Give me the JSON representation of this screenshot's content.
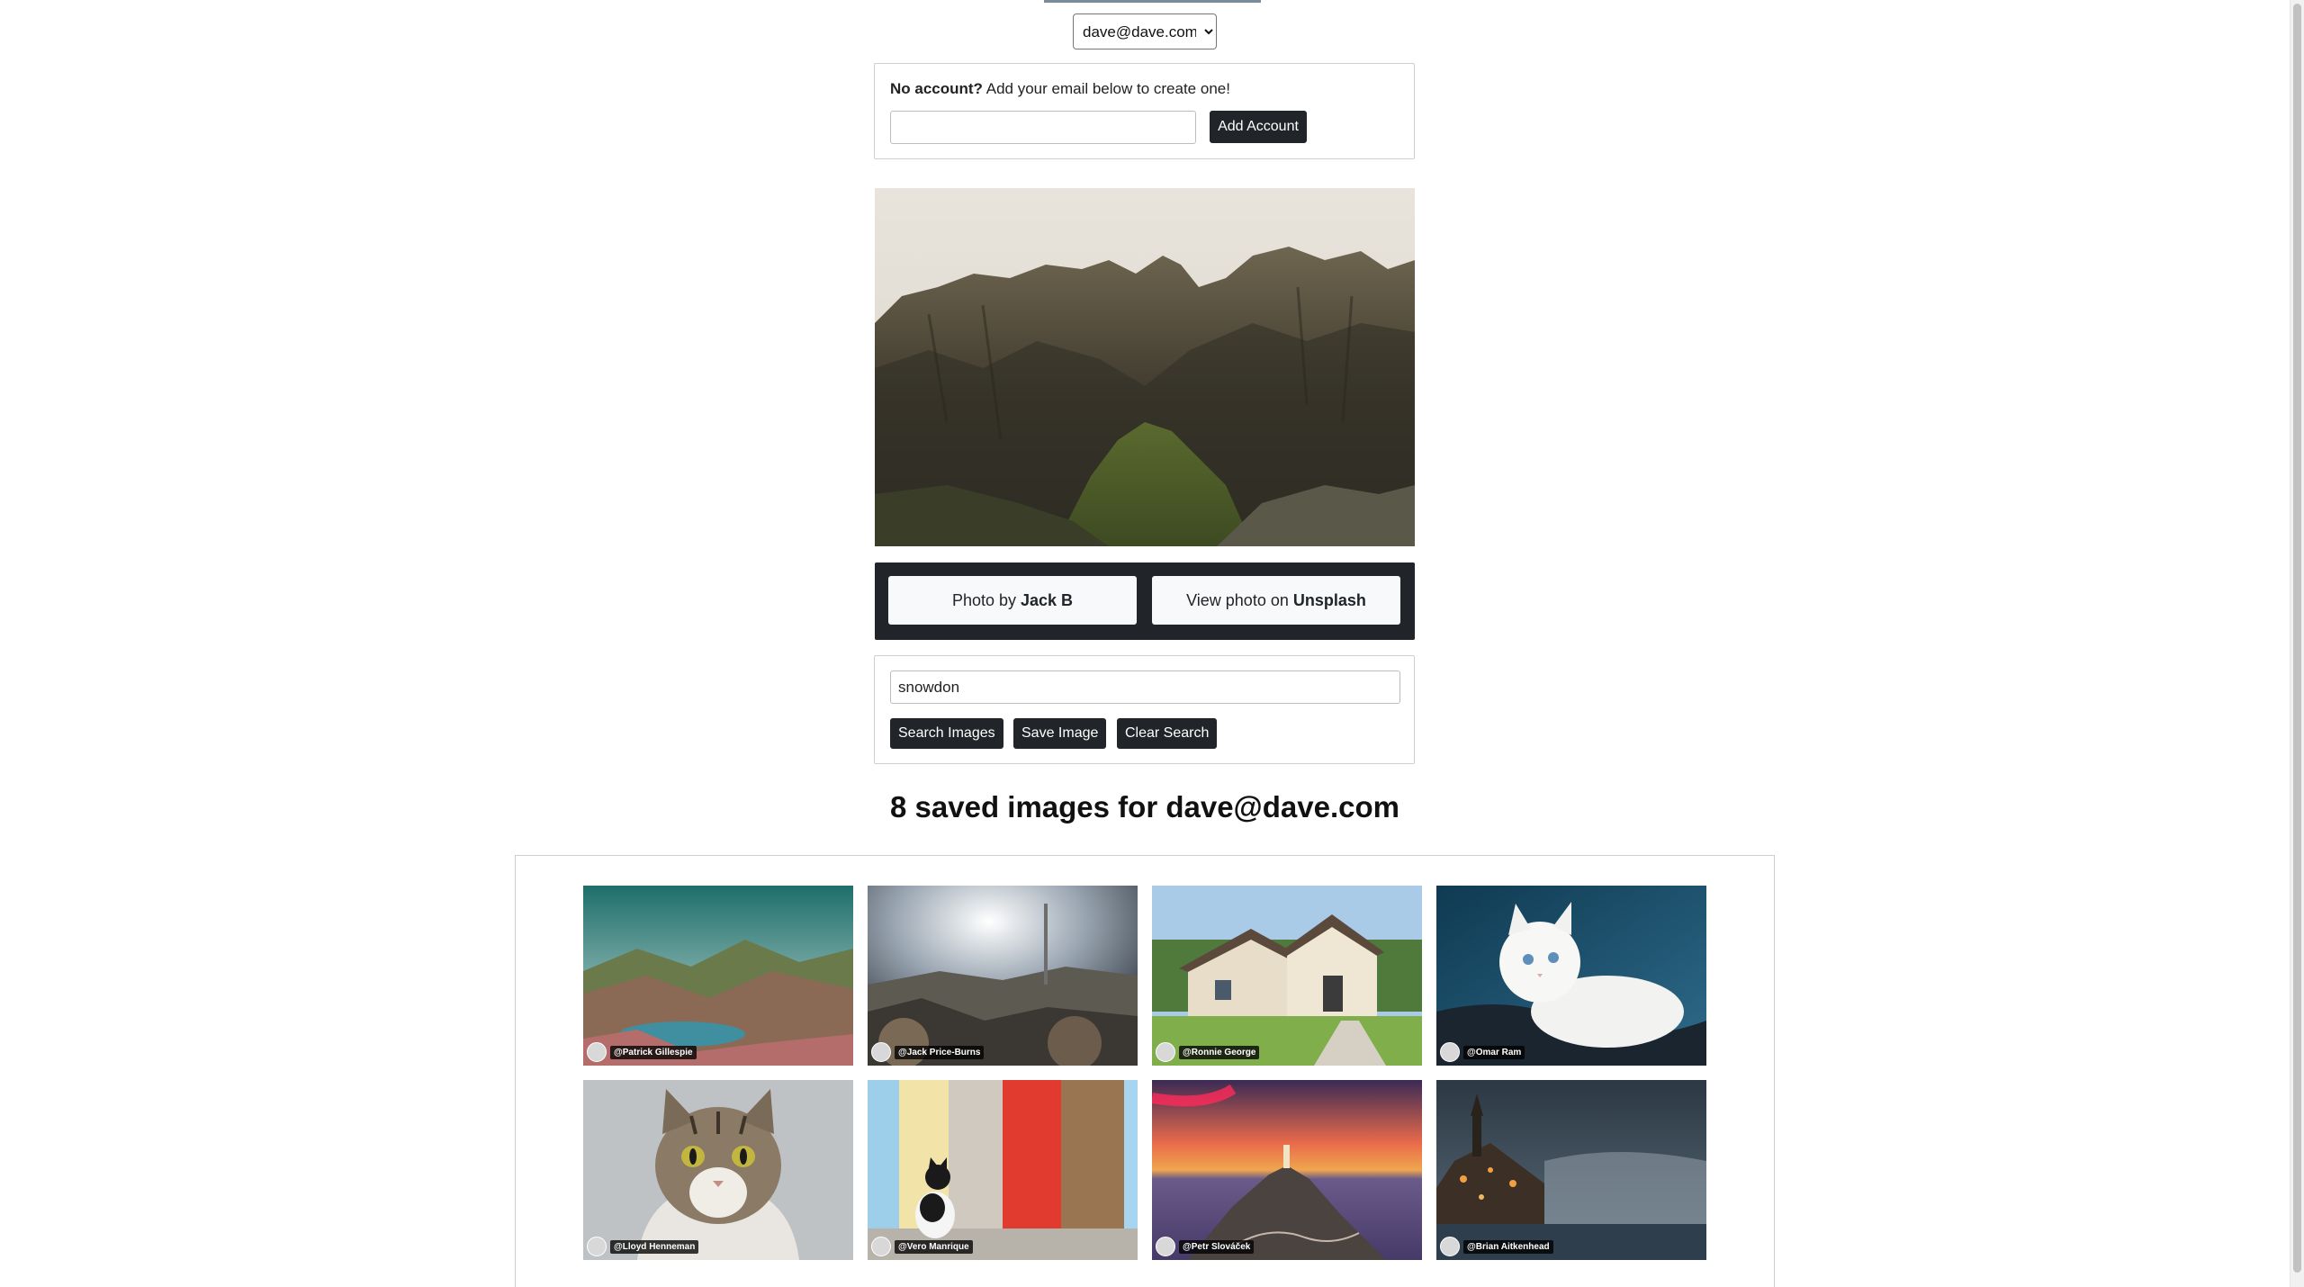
{
  "account": {
    "selected_email": "dave@dave.com",
    "no_account_bold": "No account?",
    "no_account_text": " Add your email below to create one!",
    "email_value": "",
    "add_account_label": "Add Account"
  },
  "photo": {
    "credit_prefix": "Photo by ",
    "author": "Jack B",
    "view_prefix": "View photo on ",
    "source": "Unsplash"
  },
  "search": {
    "query": "snowdon",
    "search_label": "Search Images",
    "save_label": "Save Image",
    "clear_label": "Clear Search"
  },
  "saved": {
    "heading": "8 saved images for dave@dave.com",
    "images": [
      {
        "credit": "@Patrick Gillespie",
        "scene": "lake-mountains"
      },
      {
        "credit": "@Jack Price-Burns",
        "scene": "rocky-sky"
      },
      {
        "credit": "@Ronnie George",
        "scene": "house"
      },
      {
        "credit": "@Omar Ram",
        "scene": "white-kitten"
      },
      {
        "credit": "@Lloyd Henneman",
        "scene": "tabby-cat"
      },
      {
        "credit": "@Vero Manrique",
        "scene": "cat-colored-wall"
      },
      {
        "credit": "@Petr Slováček",
        "scene": "lighthouse-sunset"
      },
      {
        "credit": "@Brian Aitkenhead",
        "scene": "night-coast"
      }
    ]
  }
}
